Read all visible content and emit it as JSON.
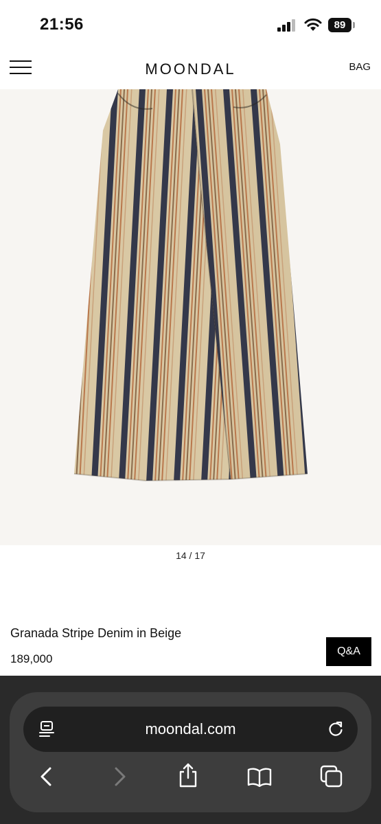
{
  "status_bar": {
    "time": "21:56",
    "battery": "89"
  },
  "header": {
    "logo": "MOONDAL",
    "bag_label": "BAG"
  },
  "gallery": {
    "pager": "14 / 17"
  },
  "product": {
    "name": "Granada Stripe Denim in Beige",
    "price": "189,000",
    "qa_label": "Q&A"
  },
  "browser": {
    "url": "moondal.com"
  },
  "colors": {
    "beige": "#d9c8a4",
    "navy_stripe": "#34384a",
    "rust_stripe": "#b9774c",
    "image_bg": "#f7f5f2"
  }
}
